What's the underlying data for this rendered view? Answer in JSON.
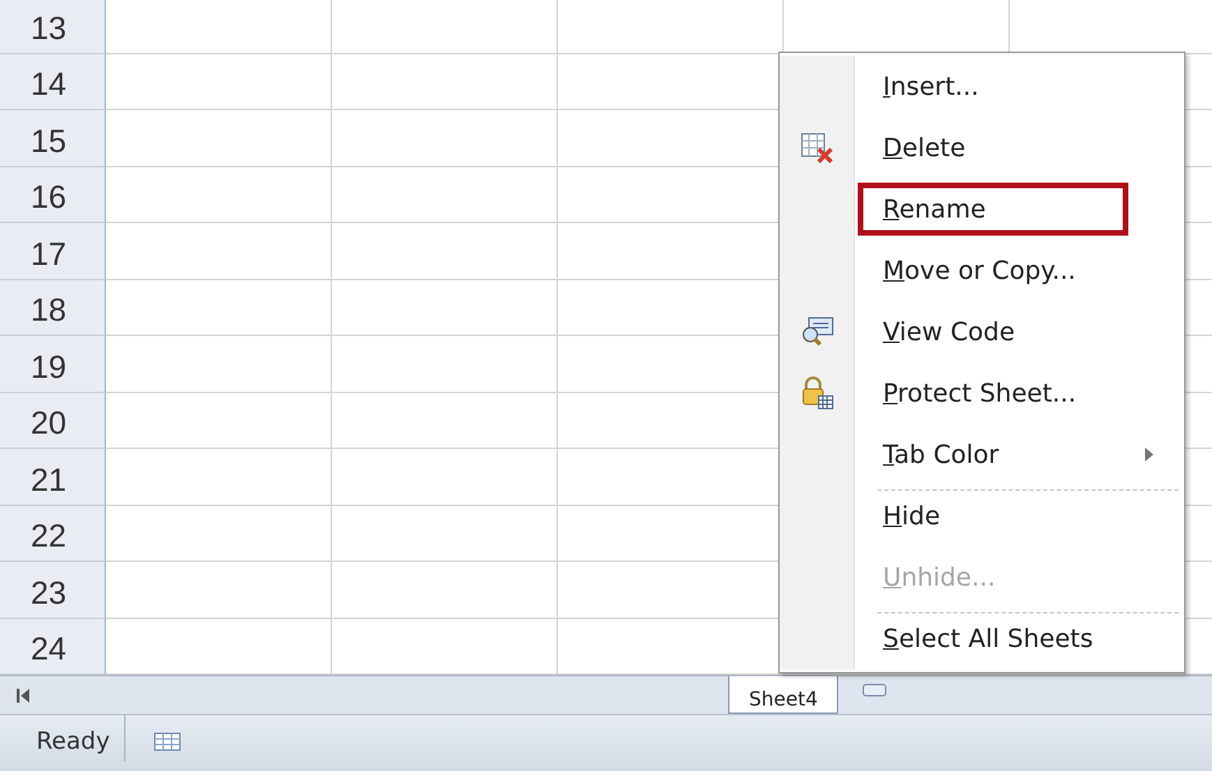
{
  "grid": {
    "rows": [
      "13",
      "14",
      "15",
      "16",
      "17",
      "18",
      "19",
      "20",
      "21",
      "22",
      "23",
      "24"
    ]
  },
  "sheet_tabs": [
    {
      "label": "Sheet4",
      "selected": true
    }
  ],
  "context_menu": {
    "items": [
      {
        "label": "Insert...",
        "kind": "plain",
        "separator_before": false,
        "disabled": false,
        "submenu": false,
        "highlighted": false
      },
      {
        "label": "Delete",
        "kind": "delete",
        "separator_before": false,
        "disabled": false,
        "submenu": false,
        "highlighted": false
      },
      {
        "label": "Rename",
        "kind": "plain",
        "separator_before": false,
        "disabled": false,
        "submenu": false,
        "highlighted": true
      },
      {
        "label": "Move or Copy...",
        "kind": "plain",
        "separator_before": false,
        "disabled": false,
        "submenu": false,
        "highlighted": false
      },
      {
        "label": "View Code",
        "kind": "code",
        "separator_before": false,
        "disabled": false,
        "submenu": false,
        "highlighted": false
      },
      {
        "label": "Protect Sheet...",
        "kind": "protect",
        "separator_before": false,
        "disabled": false,
        "submenu": false,
        "highlighted": false
      },
      {
        "label": "Tab Color",
        "kind": "plain",
        "separator_before": false,
        "disabled": false,
        "submenu": true,
        "highlighted": false
      },
      {
        "label": "Hide",
        "kind": "plain",
        "separator_before": true,
        "disabled": false,
        "submenu": false,
        "highlighted": false
      },
      {
        "label": "Unhide...",
        "kind": "plain",
        "separator_before": false,
        "disabled": true,
        "submenu": false,
        "highlighted": false
      },
      {
        "label": "Select All Sheets",
        "kind": "plain",
        "separator_before": true,
        "disabled": false,
        "submenu": false,
        "highlighted": false
      }
    ]
  },
  "status_bar": {
    "text": "Ready"
  }
}
